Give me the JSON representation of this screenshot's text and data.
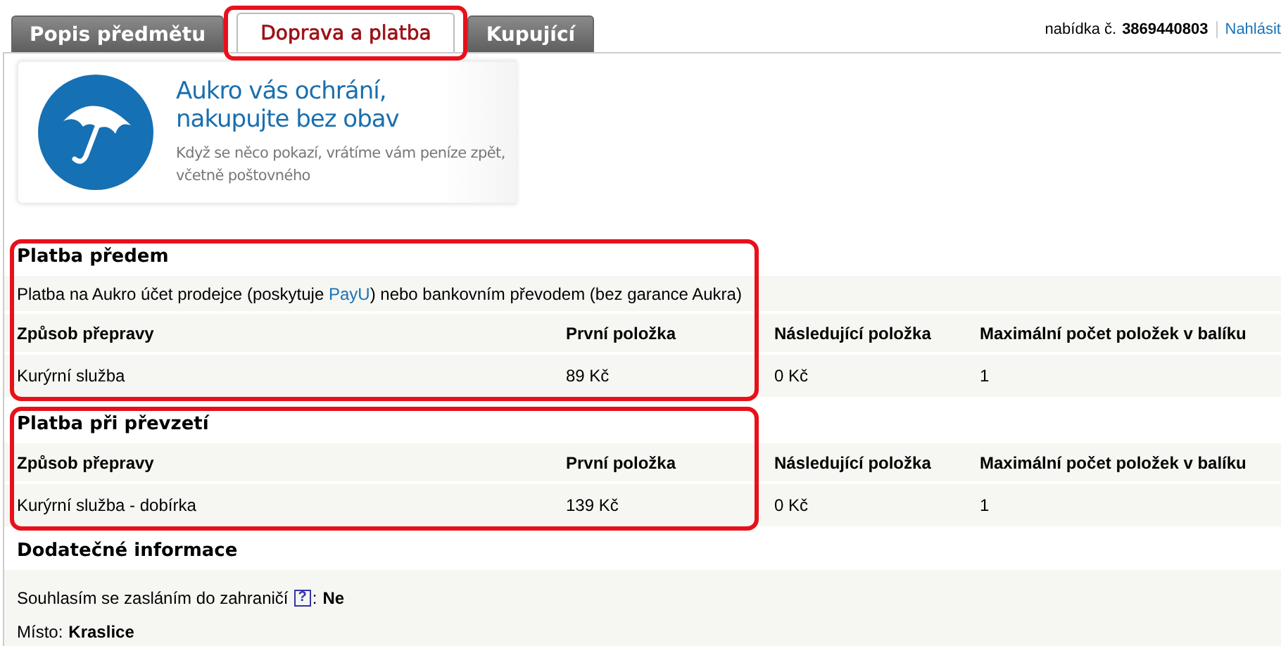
{
  "tabs": [
    {
      "label": "Popis předmětu",
      "selected": false,
      "highlighted": false
    },
    {
      "label": "Doprava a platba",
      "selected": true,
      "highlighted": true
    },
    {
      "label": "Kupující",
      "selected": false,
      "highlighted": false
    }
  ],
  "offer": {
    "label": "nabídka č.",
    "number": "3869440803",
    "report_link": "Nahlásit"
  },
  "banner": {
    "title_lines": [
      "Aukro vás ochrání,",
      "nakupujte bez obav"
    ],
    "subtitle_lines": [
      "Když se něco pokazí, vrátíme vám peníze zpět,",
      "včetně poštovného"
    ]
  },
  "sections": [
    {
      "title": "Platba předem",
      "highlighted": true,
      "description": {
        "before": "Platba na Aukro účet prodejce (poskytuje ",
        "link": "PayU",
        "after": ") nebo bankovním převodem (bez garance Aukra)"
      },
      "columns": [
        "Způsob přepravy",
        "První položka",
        "Následující položka",
        "Maximální počet položek v balíku"
      ],
      "rows": [
        [
          "Kurýrní služba",
          "89 Kč",
          "0 Kč",
          "1"
        ]
      ]
    },
    {
      "title": "Platba při převzetí",
      "highlighted": true,
      "columns": [
        "Způsob přepravy",
        "První položka",
        "Následující položka",
        "Maximální počet položek v balíku"
      ],
      "rows": [
        [
          "Kurýrní služba - dobírka",
          "139 Kč",
          "0 Kč",
          "1"
        ]
      ]
    }
  ],
  "additional": {
    "title": "Dodatečné informace",
    "items": [
      {
        "label": "Souhlasím se zasláním do zahraničí",
        "help": "?",
        "separator": ":",
        "value": "Ne"
      },
      {
        "label": "Místo:",
        "value": "Kraslice"
      }
    ]
  }
}
